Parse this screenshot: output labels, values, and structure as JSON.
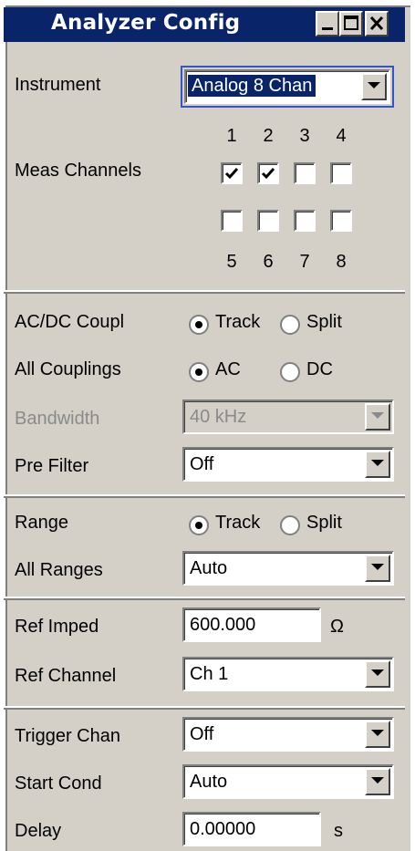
{
  "window": {
    "title": "Analyzer Config"
  },
  "instrument": {
    "label": "Instrument",
    "value": "Analog  8 Chan"
  },
  "meas_channels": {
    "label": "Meas Channels",
    "top_numbers": [
      "1",
      "2",
      "3",
      "4"
    ],
    "bottom_numbers": [
      "5",
      "6",
      "7",
      "8"
    ],
    "checked": [
      true,
      true,
      false,
      false,
      false,
      false,
      false,
      false
    ]
  },
  "acdc_coupl": {
    "label": "AC/DC Coupl",
    "options": [
      "Track",
      "Split"
    ],
    "selected": "Track"
  },
  "all_couplings": {
    "label": "All Couplings",
    "options": [
      "AC",
      "DC"
    ],
    "selected": "AC"
  },
  "bandwidth": {
    "label": "Bandwidth",
    "value": "40 kHz",
    "disabled": true
  },
  "pre_filter": {
    "label": "Pre Filter",
    "value": "Off"
  },
  "range": {
    "label": "Range",
    "options": [
      "Track",
      "Split"
    ],
    "selected": "Track"
  },
  "all_ranges": {
    "label": "All Ranges",
    "value": "Auto"
  },
  "ref_imped": {
    "label": "Ref Imped",
    "value": "600.000",
    "unit": "Ω"
  },
  "ref_channel": {
    "label": "Ref Channel",
    "value": "Ch 1"
  },
  "trigger_chan": {
    "label": "Trigger Chan",
    "value": "Off"
  },
  "start_cond": {
    "label": "Start Cond",
    "value": "Auto"
  },
  "delay": {
    "label": "Delay",
    "value": "0.00000",
    "unit": "s"
  },
  "icons": [
    "minimize-icon",
    "maximize-icon",
    "close-icon",
    "dropdown-arrow-icon",
    "checkmark-icon",
    "radio-selected-icon",
    "radio-unselected-icon"
  ]
}
